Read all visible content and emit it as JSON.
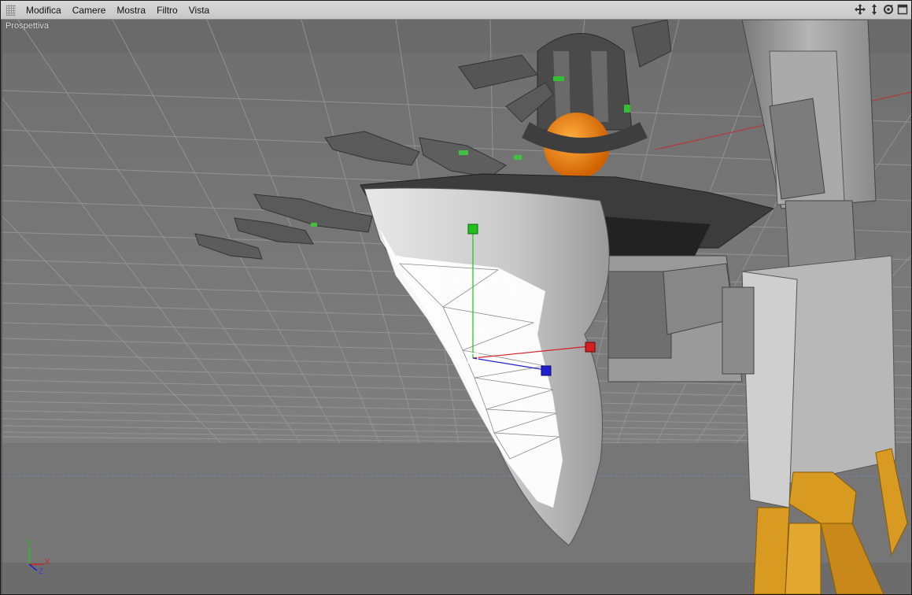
{
  "menu": {
    "modifica": "Modifica",
    "camere": "Camere",
    "mostra": "Mostra",
    "filtro": "Filtro",
    "vista": "Vista"
  },
  "nav_icons": [
    "move-icon",
    "dolly-icon",
    "rotate-icon",
    "maximize-icon"
  ],
  "viewport": {
    "camera_label": "Prospettiva"
  },
  "axis_indicator": {
    "y": "Y",
    "x": "X",
    "z": "Z"
  },
  "colors": {
    "axis_x": "#d42020",
    "axis_y": "#20c020",
    "axis_z": "#2020d0",
    "accent_orange": "#f08a10",
    "leg_gold": "#d89a20"
  }
}
